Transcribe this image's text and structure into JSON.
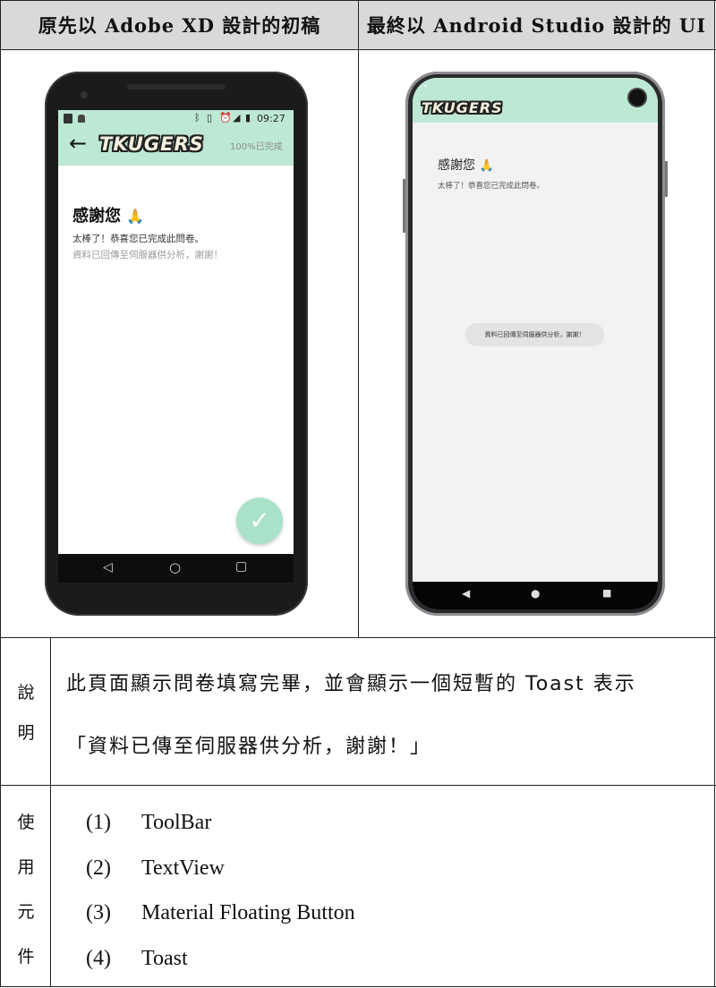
{
  "header": {
    "left_title": "原先以 Adobe XD 設計的初稿",
    "right_title": "最終以 Android Studio 設計的 UI"
  },
  "colors": {
    "toolbar_mint": "#bde9d4",
    "fab_mint": "#a9e2c9",
    "header_gray": "#d9d9d9"
  },
  "draft": {
    "status_time": "09:27",
    "status_icons": [
      "bluetooth-icon",
      "vibrate-icon",
      "alarm-icon",
      "signal-icon",
      "battery-icon"
    ],
    "app_name": "TKUGERS",
    "progress": "100%已完成",
    "heading": "感謝您",
    "emoji": "🙏",
    "line1": "太棒了！恭喜您已完成此問卷。",
    "line2": "資料已回傳至伺服器供分析，謝謝！"
  },
  "final": {
    "app_name": "TKUGERS",
    "heading": "感謝您",
    "emoji": "🙏",
    "line1": "太棒了！恭喜您已完成此問卷。",
    "toast": "資料已回傳至伺服器供分析，謝謝！"
  },
  "description": {
    "label": [
      "說",
      "明"
    ],
    "line1": "此頁面顯示問卷填寫完畢，並會顯示一個短暫的 Toast 表示",
    "line2": "「資料已傳至伺服器供分析，謝謝！」"
  },
  "components": {
    "label": [
      "使",
      "用",
      "元",
      "件"
    ],
    "items": [
      {
        "num": "(1)",
        "name": "ToolBar"
      },
      {
        "num": "(2)",
        "name": "TextView"
      },
      {
        "num": "(3)",
        "name": "Material Floating Button"
      },
      {
        "num": "(4)",
        "name": "Toast"
      }
    ]
  }
}
